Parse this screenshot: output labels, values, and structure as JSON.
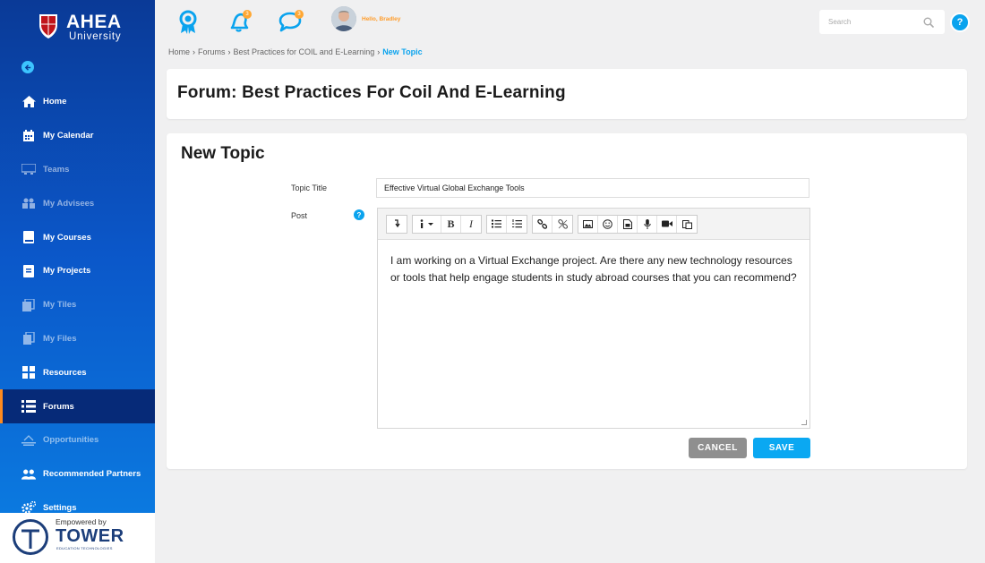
{
  "brand": {
    "name": "AHEA",
    "subtitle": "University",
    "shield_letters": [
      "A",
      "H",
      "E",
      "A"
    ]
  },
  "sidebar": {
    "items": [
      {
        "label": "Home",
        "icon": "home-icon"
      },
      {
        "label": "My Calendar",
        "icon": "calendar-icon"
      },
      {
        "label": "Teams",
        "icon": "teams-icon"
      },
      {
        "label": "My Advisees",
        "icon": "advisees-icon"
      },
      {
        "label": "My Courses",
        "icon": "book-icon"
      },
      {
        "label": "My Projects",
        "icon": "projects-icon"
      },
      {
        "label": "My Tiles",
        "icon": "tiles-icon"
      },
      {
        "label": "My Files",
        "icon": "files-icon"
      },
      {
        "label": "Resources",
        "icon": "grid-icon"
      },
      {
        "label": "Forums",
        "icon": "list-icon"
      },
      {
        "label": "Opportunities",
        "icon": "opportunities-icon"
      },
      {
        "label": "Recommended Partners",
        "icon": "partners-icon"
      },
      {
        "label": "Settings",
        "icon": "gear-icon"
      }
    ],
    "powered": {
      "empowered_by": "Empowered by",
      "brand": "TOWER",
      "tagline": "EDUCATION TECHNOLOGIES"
    }
  },
  "topbar": {
    "notifications_badge": "3",
    "messages_badge": "3",
    "greeting": "Hello, Bradley",
    "search_placeholder": "Search",
    "help_label": "?"
  },
  "breadcrumb": {
    "items": [
      "Home",
      "Forums",
      "Best Practices for COIL and E-Learning"
    ],
    "current": "New Topic",
    "separator": "›"
  },
  "forum": {
    "title": "Forum: Best Practices For Coil And E-Learning"
  },
  "form": {
    "heading": "New Topic",
    "topic_title_label": "Topic Title",
    "topic_title_value": "Effective Virtual Global Exchange Tools",
    "post_label": "Post",
    "post_help": "?",
    "post_body": "I am working on a Virtual Exchange project. Are there any new technology resources or tools that help engage students in study abroad courses that you can recommend?",
    "cancel_label": "CANCEL",
    "save_label": "SAVE"
  },
  "colors": {
    "accent": "#0aa8f2",
    "sidebar_active": "#062a78",
    "orange": "#ff9c2a"
  }
}
